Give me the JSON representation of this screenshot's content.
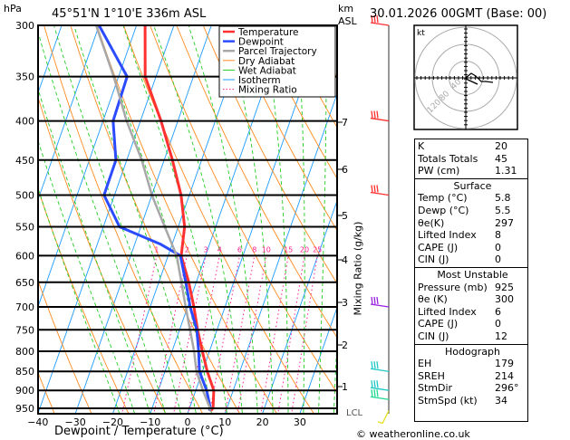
{
  "header": {
    "pressure_unit": "hPa",
    "location": "45°51'N  1°10'E  336m  ASL",
    "height_unit_1": "km",
    "height_unit_2": "ASL",
    "datetime": "30.01.2026  00GMT  (Base: 00)"
  },
  "footer": {
    "copyright": "© weatheronline.co.uk"
  },
  "chart_data": {
    "type": "skew-t",
    "xlabel": "Dewpoint / Temperature (°C)",
    "ylabel": "hPa",
    "right_axis_label": "Mixing Ratio (g/kg)",
    "xticks": [
      -40,
      -30,
      -20,
      -10,
      0,
      10,
      20,
      30
    ],
    "pressure_levels": [
      300,
      350,
      400,
      450,
      500,
      550,
      600,
      650,
      700,
      750,
      800,
      850,
      900,
      950
    ],
    "xlim": [
      -40,
      40
    ],
    "ylim": [
      960,
      300
    ],
    "y_scale": "log",
    "km_ticks": [
      "1",
      "2",
      "3",
      "4",
      "5",
      "6",
      "7"
    ],
    "lcl_label": "LCL",
    "mixing_ratio_labels": [
      "1",
      "2",
      "3",
      "4",
      "6",
      "8",
      "10",
      "15",
      "20",
      "25"
    ],
    "legend": [
      {
        "name": "Temperature",
        "color": "#ff3030",
        "style": "thick"
      },
      {
        "name": "Dewpoint",
        "color": "#2a4bff",
        "style": "thick"
      },
      {
        "name": "Parcel Trajectory",
        "color": "#a8a8a8",
        "style": "thick"
      },
      {
        "name": "Dry Adiabat",
        "color": "#ff8a1e",
        "style": "thin"
      },
      {
        "name": "Wet Adiabat",
        "color": "#22cc22",
        "style": "thin"
      },
      {
        "name": "Isotherm",
        "color": "#1e9bff",
        "style": "thin"
      },
      {
        "name": "Mixing Ratio",
        "color": "#ff2090",
        "style": "dotted"
      }
    ],
    "series": [
      {
        "name": "Temperature",
        "p": [
          957,
          950,
          900,
          850,
          800,
          750,
          700,
          650,
          600,
          550,
          500,
          450,
          400,
          350,
          300
        ],
        "t": [
          5.8,
          6.3,
          4.8,
          1.3,
          -1.9,
          -5.2,
          -8.3,
          -12,
          -16.5,
          -18.3,
          -22.2,
          -27.8,
          -34.5,
          -42.9,
          -47.7
        ]
      },
      {
        "name": "Dewpoint",
        "p": [
          957,
          950,
          900,
          850,
          800,
          750,
          700,
          650,
          600,
          580,
          550,
          500,
          450,
          400,
          350,
          300
        ],
        "t": [
          5.5,
          5.6,
          2.9,
          -0.8,
          -2.9,
          -5.4,
          -9.3,
          -12.8,
          -16.7,
          -23,
          -35.7,
          -42.8,
          -42.9,
          -47.3,
          -47.7,
          -60
        ]
      },
      {
        "name": "Parcel Trajectory",
        "p": [
          957,
          950,
          900,
          850,
          800,
          700,
          600,
          550,
          500,
          450,
          400,
          350,
          300
        ],
        "t": [
          5.8,
          5.5,
          1.9,
          -1.6,
          -4.1,
          -10.5,
          -17.7,
          -23.6,
          -30,
          -36,
          -43.7,
          -51.3,
          -60.8
        ]
      }
    ],
    "wind_barbs": [
      {
        "p": 300,
        "color": "#ff3030"
      },
      {
        "p": 400,
        "color": "#ff3030"
      },
      {
        "p": 500,
        "color": "#ff3030"
      },
      {
        "p": 700,
        "color": "#9a20e0"
      },
      {
        "p": 850,
        "color": "#20c8c8"
      },
      {
        "p": 900,
        "color": "#20c8c8"
      },
      {
        "p": 925,
        "color": "#20d890"
      },
      {
        "p": 957,
        "color": "#e8e020"
      }
    ],
    "hodograph": {
      "unit": "kt",
      "rings": [
        "40",
        "80",
        "120"
      ]
    }
  },
  "indices": {
    "general": [
      {
        "k": "K",
        "v": "20"
      },
      {
        "k": "Totals Totals",
        "v": "45"
      },
      {
        "k": "PW (cm)",
        "v": "1.31"
      }
    ],
    "surface": {
      "title": "Surface",
      "rows": [
        {
          "k": "Temp (°C)",
          "v": "5.8"
        },
        {
          "k": "Dewp (°C)",
          "v": "5.5"
        },
        {
          "k": "θe(K)",
          "v": "297"
        },
        {
          "k": "Lifted Index",
          "v": "8"
        },
        {
          "k": "CAPE (J)",
          "v": "0"
        },
        {
          "k": "CIN (J)",
          "v": "0"
        }
      ]
    },
    "most_unstable": {
      "title": "Most Unstable",
      "rows": [
        {
          "k": "Pressure (mb)",
          "v": "925"
        },
        {
          "k": "θe (K)",
          "v": "300"
        },
        {
          "k": "Lifted Index",
          "v": "6"
        },
        {
          "k": "CAPE (J)",
          "v": "0"
        },
        {
          "k": "CIN (J)",
          "v": "12"
        }
      ]
    },
    "hodograph": {
      "title": "Hodograph",
      "rows": [
        {
          "k": "EH",
          "v": "179"
        },
        {
          "k": "SREH",
          "v": "214"
        },
        {
          "k": "StmDir",
          "v": "296°"
        },
        {
          "k": "StmSpd (kt)",
          "v": "34"
        }
      ]
    }
  }
}
